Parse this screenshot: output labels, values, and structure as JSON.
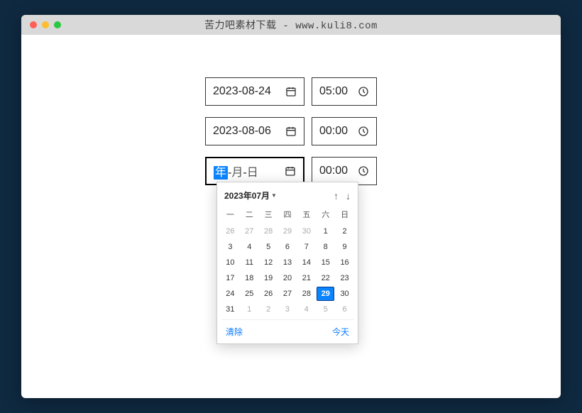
{
  "window": {
    "title": "苦力吧素材下载 - www.kuli8.com"
  },
  "rows": [
    {
      "date": "2023-08-24",
      "time": "05:00"
    },
    {
      "date": "2023-08-06",
      "time": "00:00"
    },
    {
      "date_placeholder": {
        "year": "年",
        "sep": "-",
        "month": "月",
        "day": "日"
      },
      "time": "00:00"
    }
  ],
  "calendar": {
    "title": "2023年07月",
    "weekdays": [
      "一",
      "二",
      "三",
      "四",
      "五",
      "六",
      "日"
    ],
    "prev_trailing": [
      26,
      27,
      28,
      29,
      30
    ],
    "days_start_other": false,
    "days": [
      {
        "n": 26,
        "other": true
      },
      {
        "n": 27,
        "other": true
      },
      {
        "n": 28,
        "other": true
      },
      {
        "n": 29,
        "other": true
      },
      {
        "n": 30,
        "other": true
      },
      {
        "n": 1
      },
      {
        "n": 2
      },
      {
        "n": 3
      },
      {
        "n": 4
      },
      {
        "n": 5
      },
      {
        "n": 6
      },
      {
        "n": 7
      },
      {
        "n": 8
      },
      {
        "n": 9
      },
      {
        "n": 10
      },
      {
        "n": 11
      },
      {
        "n": 12
      },
      {
        "n": 13
      },
      {
        "n": 14
      },
      {
        "n": 15
      },
      {
        "n": 16
      },
      {
        "n": 17
      },
      {
        "n": 18
      },
      {
        "n": 19
      },
      {
        "n": 20
      },
      {
        "n": 21
      },
      {
        "n": 22
      },
      {
        "n": 23
      },
      {
        "n": 24
      },
      {
        "n": 25
      },
      {
        "n": 26
      },
      {
        "n": 27
      },
      {
        "n": 28
      },
      {
        "n": 29,
        "selected": true
      },
      {
        "n": 30
      },
      {
        "n": 31
      },
      {
        "n": 1,
        "other": true
      },
      {
        "n": 2,
        "other": true
      },
      {
        "n": 3,
        "other": true
      },
      {
        "n": 4,
        "other": true
      },
      {
        "n": 5,
        "other": true
      },
      {
        "n": 6,
        "other": true
      }
    ],
    "clear": "清除",
    "today": "今天"
  }
}
